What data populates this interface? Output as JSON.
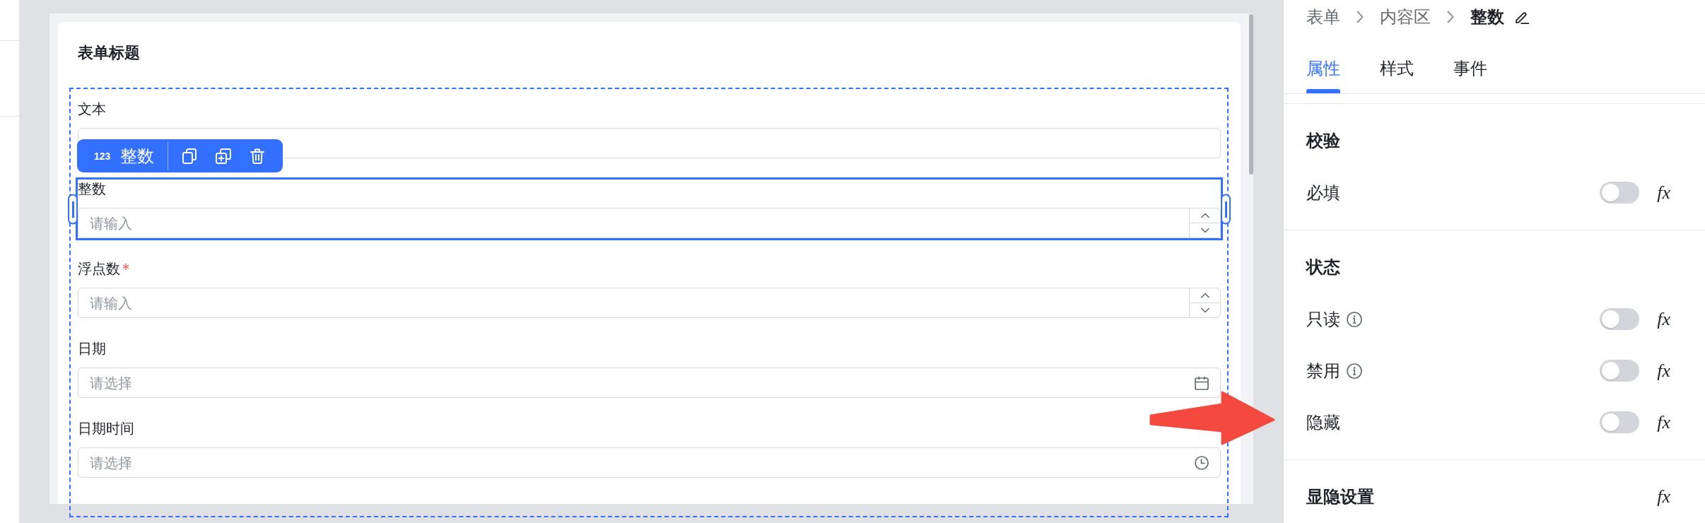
{
  "canvas": {
    "form_title": "表单标题",
    "toolbar": {
      "type_icon": "123",
      "label": "整数"
    },
    "fields": [
      {
        "kind": "text",
        "label": "文本",
        "selected": false
      },
      {
        "kind": "number",
        "label": "整数",
        "placeholder": "请输入",
        "selected": true
      },
      {
        "kind": "number",
        "label": "浮点数",
        "required_mark": "*",
        "placeholder": "请输入",
        "selected": false
      },
      {
        "kind": "date",
        "label": "日期",
        "placeholder": "请选择",
        "selected": false
      },
      {
        "kind": "datetime",
        "label": "日期时间",
        "placeholder": "请选择",
        "selected": false
      }
    ]
  },
  "properties_panel": {
    "breadcrumb": [
      {
        "label": "表单",
        "current": false
      },
      {
        "label": "内容区",
        "current": false
      },
      {
        "label": "整数",
        "current": true
      }
    ],
    "tabs": [
      {
        "label": "属性",
        "selected": true
      },
      {
        "label": "样式",
        "selected": false
      },
      {
        "label": "事件",
        "selected": false
      }
    ],
    "sections": [
      {
        "title": "校验",
        "rows": [
          {
            "label": "必填",
            "info": false,
            "on": false,
            "formula": "fx"
          }
        ]
      },
      {
        "title": "状态",
        "rows": [
          {
            "label": "只读",
            "info": true,
            "on": false,
            "formula": "fx"
          },
          {
            "label": "禁用",
            "info": true,
            "on": false,
            "formula": "fx"
          },
          {
            "label": "隐藏",
            "info": false,
            "on": false,
            "formula": "fx"
          }
        ]
      },
      {
        "title": "显隐设置",
        "formula": "fx"
      }
    ]
  }
}
